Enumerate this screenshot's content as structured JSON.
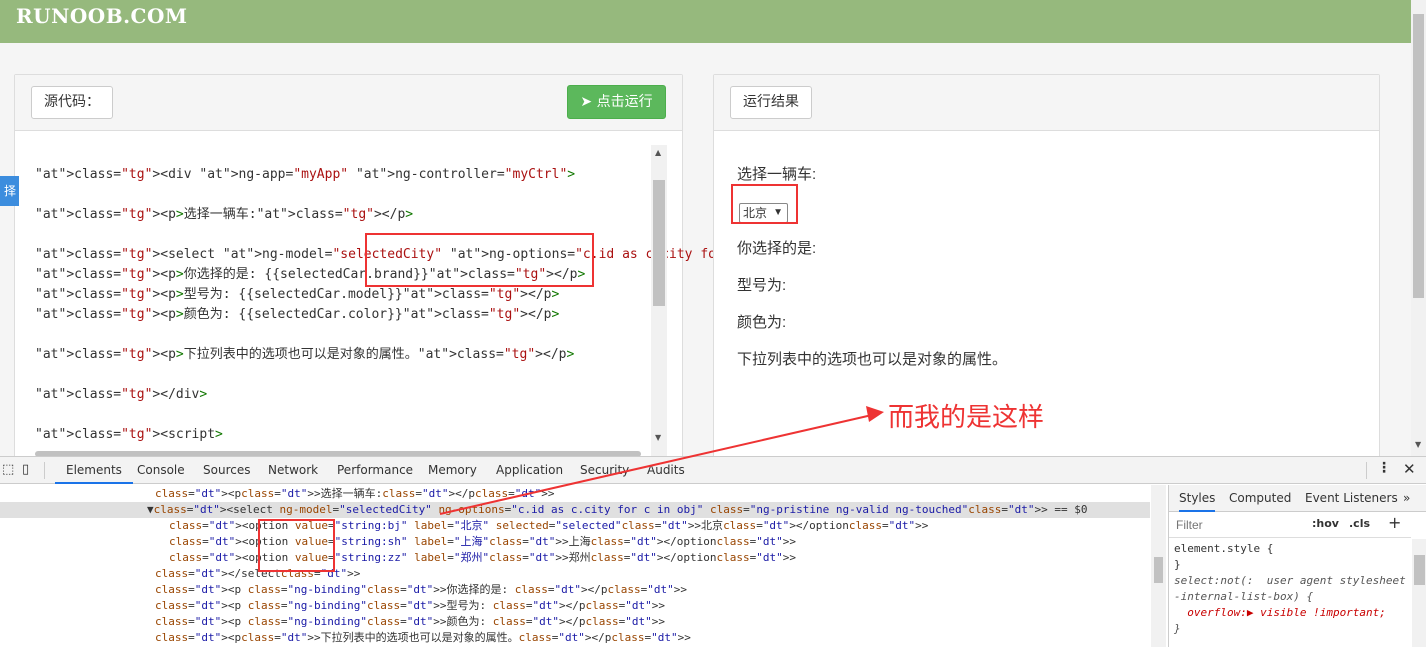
{
  "header": {
    "logo": "RUNOOB.COM"
  },
  "editor": {
    "source_label": "源代码：",
    "run_label": "点击运行",
    "code_lines": [
      "",
      "<div ng-app=\"myApp\" ng-controller=\"myCtrl\">",
      "",
      "<p>选择一辆车:</p>",
      "",
      "<select ng-model=\"selectedCity\" ng-options=\"c.id as c.city for c in obj\"></selec",
      "<p>你选择的是: {{selectedCar.brand}}</p>",
      "<p>型号为: {{selectedCar.model}}</p>",
      "<p>颜色为: {{selectedCar.color}}</p>",
      "",
      "<p>下拉列表中的选项也可以是对象的属性。</p>",
      "",
      "</div>",
      "",
      "<script>"
    ]
  },
  "result": {
    "label": "运行结果",
    "choose": "选择一辆车:",
    "select_value": "北京",
    "chosen": "你选择的是:",
    "model": "型号为:",
    "color": "颜色为:",
    "note": "下拉列表中的选项也可以是对象的属性。"
  },
  "side_tab": "择",
  "annotation": "而我的是这样",
  "devtools": {
    "tabs": [
      "Elements",
      "Console",
      "Sources",
      "Network",
      "Performance",
      "Memory",
      "Application",
      "Security",
      "Audits"
    ],
    "dom_lines": [
      "<p>选择一辆车:</p>",
      "▼<select ng-model=\"selectedCity\" ng-options=\"c.id as c.city for c in obj\" class=\"ng-pristine ng-valid ng-touched\"> == $0",
      "<option value=\"string:bj\" label=\"北京\" selected=\"selected\">北京</option>",
      "<option value=\"string:sh\" label=\"上海\">上海</option>",
      "<option value=\"string:zz\" label=\"郑州\">郑州</option>",
      "</select>",
      "<p class=\"ng-binding\">你选择的是: </p>",
      "<p class=\"ng-binding\">型号为: </p>",
      "<p class=\"ng-binding\">颜色为: </p>",
      "<p>下拉列表中的选项也可以是对象的属性。</p>"
    ],
    "styles_tabs": [
      "Styles",
      "Computed",
      "Event Listeners"
    ],
    "filter_placeholder": "Filter",
    "hov": ":hov",
    "cls": ".cls",
    "rules": [
      "element.style {",
      "}",
      "select:not(:  user agent stylesheet",
      "-internal-list-box) {",
      "  overflow:▶ visible !important;",
      "}"
    ]
  }
}
